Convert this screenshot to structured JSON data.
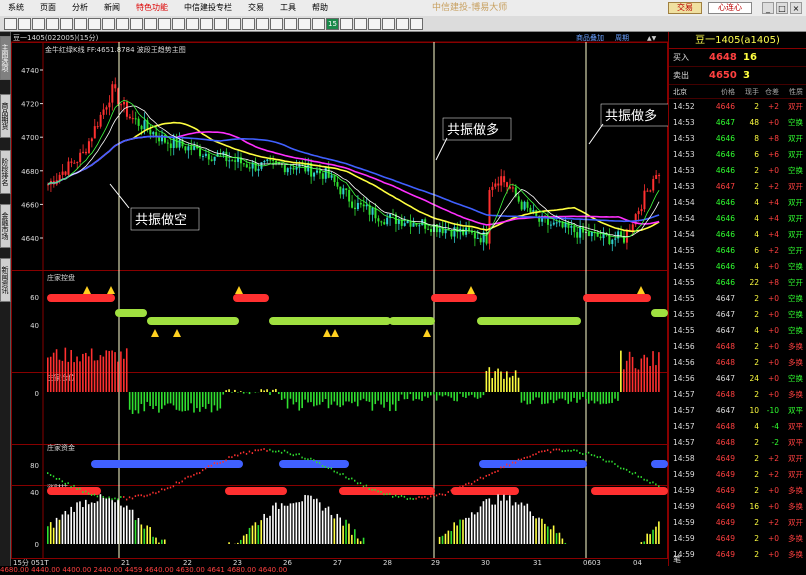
{
  "menu": {
    "items": [
      "系统",
      "页面",
      "分析",
      "新闻",
      "特色功能",
      "中信建投专栏",
      "交易",
      "工具",
      "帮助"
    ],
    "active_index": 4,
    "brand": "中信建投-博易大师",
    "trade_button": "交易",
    "heart_button": "心连心",
    "window_buttons": [
      "_",
      "□",
      "×"
    ]
  },
  "toolbar": {
    "highlight_label": "15"
  },
  "side_tabs": [
    "主图选项",
    "商品期货",
    "阶段排名",
    "金融市场",
    "新闻资讯"
  ],
  "chart": {
    "header_left": "豆一1405(022005)(15分)",
    "header_right_links": [
      "商品叠加",
      "周期"
    ],
    "main_indicator": "金牛红绿K线  FF:4651.8784  波段王趋势主图",
    "y_ticks": [
      4740,
      4720,
      4700,
      4680,
      4660,
      4640
    ],
    "annotations": [
      "共振做空",
      "共振做多",
      "共振做多"
    ],
    "sub_panels": [
      {
        "title": "庄家控盘",
        "ticks": [
          "60",
          "40"
        ]
      },
      {
        "title": "庄家仓位",
        "ticks": [
          "20",
          "0"
        ]
      },
      {
        "title": "庄家资金",
        "ticks": [
          "80",
          "40"
        ]
      },
      {
        "title": "涨财柱",
        "ticks": [
          "40",
          "20",
          "0"
        ]
      }
    ],
    "x_labels": [
      "15分",
      "051T",
      "21",
      "22",
      "23",
      "26",
      "27",
      "28",
      "29",
      "30",
      "31",
      "0603",
      "04"
    ]
  },
  "quote": {
    "title": "豆一1405(a1405)",
    "buy_label": "买入",
    "buy_price": "4648",
    "buy_volume": "16",
    "sell_label": "卖出",
    "sell_price": "4650",
    "sell_volume": "3",
    "columns": [
      "北京",
      "价格",
      "现手",
      "仓差",
      "性质"
    ],
    "rows": [
      {
        "time": "14:52",
        "price": "4646",
        "vol": "2",
        "oi": "+2",
        "nature": "双开",
        "color": "red"
      },
      {
        "time": "14:53",
        "price": "4647",
        "vol": "48",
        "oi": "+0",
        "nature": "空换",
        "color": "green"
      },
      {
        "time": "14:53",
        "price": "4646",
        "vol": "8",
        "oi": "+8",
        "nature": "双开",
        "color": "green"
      },
      {
        "time": "14:53",
        "price": "4646",
        "vol": "6",
        "oi": "+6",
        "nature": "双开",
        "color": "green"
      },
      {
        "time": "14:53",
        "price": "4646",
        "vol": "2",
        "oi": "+0",
        "nature": "空换",
        "color": "green"
      },
      {
        "time": "14:53",
        "price": "4647",
        "vol": "2",
        "oi": "+2",
        "nature": "双开",
        "color": "red"
      },
      {
        "time": "14:54",
        "price": "4646",
        "vol": "4",
        "oi": "+4",
        "nature": "双开",
        "color": "green"
      },
      {
        "time": "14:54",
        "price": "4646",
        "vol": "4",
        "oi": "+4",
        "nature": "双开",
        "color": "green"
      },
      {
        "time": "14:54",
        "price": "4646",
        "vol": "4",
        "oi": "+4",
        "nature": "双开",
        "color": "green"
      },
      {
        "time": "14:55",
        "price": "4646",
        "vol": "6",
        "oi": "+2",
        "nature": "空开",
        "color": "green"
      },
      {
        "time": "14:55",
        "price": "4646",
        "vol": "4",
        "oi": "+0",
        "nature": "空换",
        "color": "green"
      },
      {
        "time": "14:55",
        "price": "4646",
        "vol": "22",
        "oi": "+8",
        "nature": "空开",
        "color": "green"
      },
      {
        "time": "14:55",
        "price": "4647",
        "vol": "2",
        "oi": "+0",
        "nature": "空换",
        "color": "white"
      },
      {
        "time": "14:55",
        "price": "4647",
        "vol": "2",
        "oi": "+0",
        "nature": "空换",
        "color": "white"
      },
      {
        "time": "14:55",
        "price": "4647",
        "vol": "4",
        "oi": "+0",
        "nature": "空换",
        "color": "white"
      },
      {
        "time": "14:56",
        "price": "4648",
        "vol": "2",
        "oi": "+0",
        "nature": "多换",
        "color": "red"
      },
      {
        "time": "14:56",
        "price": "4648",
        "vol": "2",
        "oi": "+0",
        "nature": "多换",
        "color": "red"
      },
      {
        "time": "14:56",
        "price": "4647",
        "vol": "24",
        "oi": "+0",
        "nature": "空换",
        "color": "white"
      },
      {
        "time": "14:57",
        "price": "4648",
        "vol": "2",
        "oi": "+0",
        "nature": "多换",
        "color": "red"
      },
      {
        "time": "14:57",
        "price": "4647",
        "vol": "10",
        "oi": "-10",
        "nature": "双平",
        "color": "white"
      },
      {
        "time": "14:57",
        "price": "4648",
        "vol": "4",
        "oi": "-4",
        "nature": "双平",
        "color": "red"
      },
      {
        "time": "14:57",
        "price": "4648",
        "vol": "2",
        "oi": "-2",
        "nature": "双平",
        "color": "red"
      },
      {
        "time": "14:58",
        "price": "4649",
        "vol": "2",
        "oi": "+2",
        "nature": "双开",
        "color": "red"
      },
      {
        "time": "14:59",
        "price": "4649",
        "vol": "2",
        "oi": "+2",
        "nature": "双开",
        "color": "red"
      },
      {
        "time": "14:59",
        "price": "4649",
        "vol": "2",
        "oi": "+0",
        "nature": "多换",
        "color": "red"
      },
      {
        "time": "14:59",
        "price": "4649",
        "vol": "16",
        "oi": "+0",
        "nature": "多换",
        "color": "red"
      },
      {
        "time": "14:59",
        "price": "4649",
        "vol": "2",
        "oi": "+2",
        "nature": "双开",
        "color": "red"
      },
      {
        "time": "14:59",
        "price": "4649",
        "vol": "2",
        "oi": "+0",
        "nature": "多换",
        "color": "red"
      },
      {
        "time": "14:59",
        "price": "4649",
        "vol": "2",
        "oi": "+0",
        "nature": "多换",
        "color": "red"
      },
      {
        "time": "14:59",
        "price": "4648",
        "vol": "2",
        "oi": "-2",
        "nature": "双平",
        "color": "red"
      },
      {
        "time": "14:59",
        "price": "4650",
        "vol": "2",
        "oi": "+0",
        "nature": "多换",
        "color": "red"
      }
    ],
    "bottom_tab": "笔"
  },
  "status_strip": "4680.00  4440.00  4400.00  2440.00  4459  4640.00  4630.00  4641  4680.00  4640.00",
  "colors": {
    "up": "#ff3030",
    "down": "#30d0d0",
    "green_bar": "#30e030",
    "yellow": "#ffff40",
    "magenta": "#ff30ff",
    "blue": "#4060ff",
    "signal_line": "#ffffd0"
  }
}
